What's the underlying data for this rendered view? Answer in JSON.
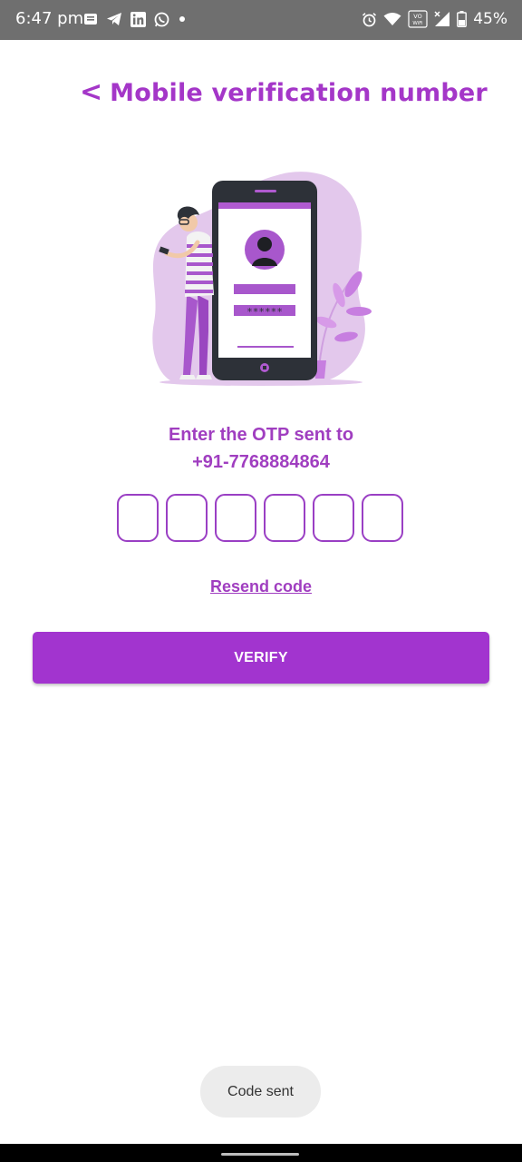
{
  "status_bar": {
    "time": "6:47 pm",
    "battery": "45%",
    "left_icons": [
      "message-icon",
      "telegram-icon",
      "linkedin-icon",
      "whatsapp-icon",
      "dot-icon"
    ],
    "right_icons": [
      "alarm-icon",
      "wifi-icon",
      "vowifi-icon",
      "signal-icon",
      "battery-icon"
    ],
    "vowifi_label": "VoWiFi"
  },
  "header": {
    "back_label": "<",
    "title": "Mobile verification number"
  },
  "illustration": {
    "icon": "phone-login-illustration",
    "password_mask": "******"
  },
  "otp": {
    "prompt_line1": "Enter the OTP sent to",
    "phone_number": "+91-7768884864",
    "digits": [
      "",
      "",
      "",
      "",
      "",
      ""
    ]
  },
  "resend_label": "Resend code",
  "verify_label": "VERIFY",
  "toast": "Code sent",
  "colors": {
    "accent": "#a436c8",
    "button": "#a234cf",
    "status_bar": "#6f6f6f"
  }
}
